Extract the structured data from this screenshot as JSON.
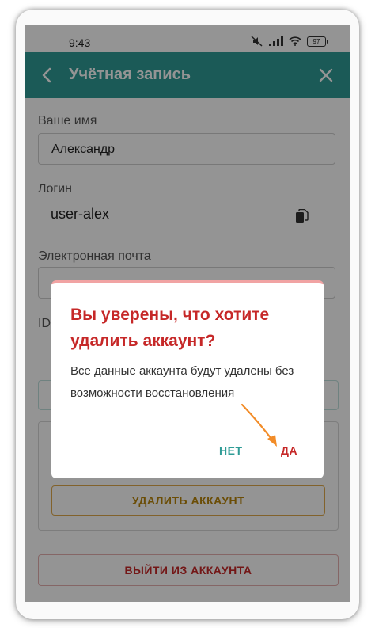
{
  "status_bar": {
    "time": "9:43",
    "battery": "97",
    "icons": [
      "mute-icon",
      "signal-icon",
      "wifi-icon",
      "battery-icon"
    ]
  },
  "app_bar": {
    "title": "Учётная запись",
    "color": "#2f9c96"
  },
  "form": {
    "name_label": "Ваше имя",
    "name_value": "Александр",
    "login_label": "Логин",
    "login_value": "user-alex",
    "email_label": "Электронная почта",
    "email_value": "",
    "id_label": "ID"
  },
  "buttons": {
    "delete_account": "УДАЛИТЬ АККАУНТ",
    "logout": "ВЫЙТИ ИЗ АККАУНТА"
  },
  "dialog": {
    "title": "Вы уверены, что хотите удалить аккаунт?",
    "body": "Все данные аккаунта будут удалены без возможности восстановления",
    "no_label": "НЕТ",
    "yes_label": "ДА"
  },
  "colors": {
    "accent": "#2f9c96",
    "danger": "#c62828",
    "warning": "#b8860b",
    "annotation_arrow": "#f28c28"
  }
}
